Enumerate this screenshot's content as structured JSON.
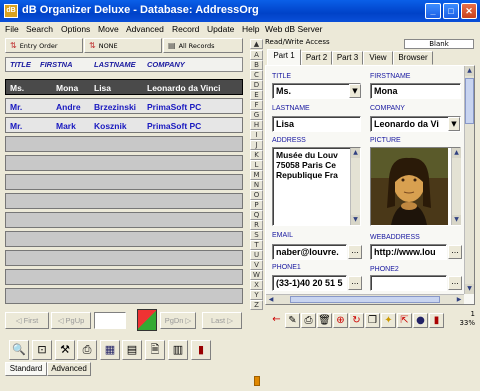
{
  "window": {
    "title": "dB Organizer Deluxe - Database: AddressOrg",
    "app_icon_text": "dB"
  },
  "menu": [
    "File",
    "Search",
    "Options",
    "Move",
    "Advanced",
    "Record",
    "Update",
    "Help",
    "Web dB Server"
  ],
  "order_buttons": {
    "entry_order": "Entry Order",
    "none": "NONE",
    "all_records": "All Records"
  },
  "list": {
    "columns": [
      "TITLE",
      "FIRSTNA",
      "LASTNAME",
      "COMPANY"
    ],
    "rows": [
      {
        "title": "Ms.",
        "first": "Mona",
        "last": "Lisa",
        "company": "Leonardo da Vinci"
      },
      {
        "title": "Mr.",
        "first": "Andre",
        "last": "Brzezinski",
        "company": "PrimaSoft PC"
      },
      {
        "title": "Mr.",
        "first": "Mark",
        "last": "Kosznik",
        "company": "PrimaSoft PC"
      }
    ]
  },
  "alphabet": [
    "A",
    "B",
    "C",
    "D",
    "E",
    "F",
    "G",
    "H",
    "I",
    "J",
    "K",
    "L",
    "M",
    "N",
    "O",
    "P",
    "Q",
    "R",
    "S",
    "T",
    "U",
    "V",
    "W",
    "X",
    "Y",
    "Z"
  ],
  "nav": {
    "first": "First",
    "pgup": "PgUp",
    "pgdn": "PgDn",
    "last": "Last",
    "record_input": ""
  },
  "access": "Read/Write Access",
  "blank_field": "Blank",
  "tabs": [
    "Part 1",
    "Part 2",
    "Part 3",
    "View",
    "Browser"
  ],
  "form": {
    "title_label": "TITLE",
    "title_value": "Ms.",
    "firstname_label": "FIRSTNAME",
    "firstname_value": "Mona",
    "lastname_label": "LASTNAME",
    "lastname_value": "Lisa",
    "company_label": "COMPANY",
    "company_value": "Leonardo da Vi",
    "address_label": "ADDRESS",
    "address_lines": [
      "Musée du Louv",
      "75058 Paris Ce",
      "Republique Fra"
    ],
    "picture_label": "PICTURE",
    "email_label": "EMAIL",
    "email_value": "naber@louvre.",
    "webaddress_label": "WEBADDRESS",
    "webaddress_value": "http://www.lou",
    "phone1_label": "PHONE1",
    "phone1_value": "(33-1)40 20 51 5",
    "phone2_label": "PHONE2",
    "phone2_value": ""
  },
  "record_info": {
    "count": "1",
    "percent": "33%"
  },
  "bottom_tabs": [
    "Standard",
    "Advanced"
  ],
  "colors": {
    "titlebar": "#0a5fe8",
    "selected_row": "#4a4a4a",
    "data_text": "#1818c0",
    "label_text": "#1818a0"
  }
}
